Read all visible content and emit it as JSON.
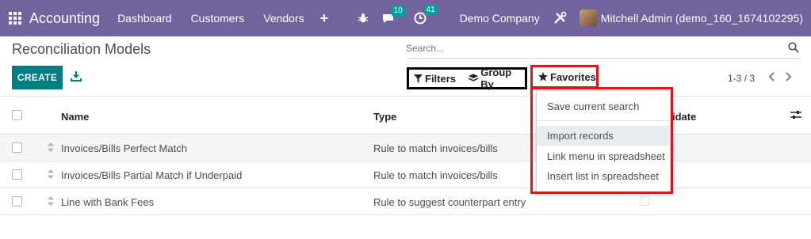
{
  "navbar": {
    "app_name": "Accounting",
    "menu": [
      "Dashboard",
      "Customers",
      "Vendors"
    ],
    "messages_count": "10",
    "activities_count": "41",
    "company": "Demo Company",
    "user": "Mitchell Admin (demo_160_1674102295)",
    "bg_color": "#71639e"
  },
  "page": {
    "title": "Reconciliation Models",
    "search_placeholder": "Search...",
    "create_label": "CREATE",
    "filters_label": "Filters",
    "groupby_label": "Group By",
    "favorites_label": "Favorites",
    "pager": "1-3 / 3"
  },
  "table": {
    "headers": {
      "name": "Name",
      "type": "Type",
      "auto": "idate"
    },
    "rows": [
      {
        "name": "Invoices/Bills Perfect Match",
        "type": "Rule to match invoices/bills"
      },
      {
        "name": "Invoices/Bills Partial Match if Underpaid",
        "type": "Rule to match invoices/bills"
      },
      {
        "name": "Line with Bank Fees",
        "type": "Rule to suggest counterpart entry"
      }
    ]
  },
  "favorites_menu": {
    "items": [
      "Save current search",
      "Import records",
      "Link menu in spreadsheet",
      "Insert list in spreadsheet"
    ]
  },
  "colors": {
    "primary": "#017e84",
    "highlight_box": "#e0141d",
    "badge": "#00a09d"
  }
}
